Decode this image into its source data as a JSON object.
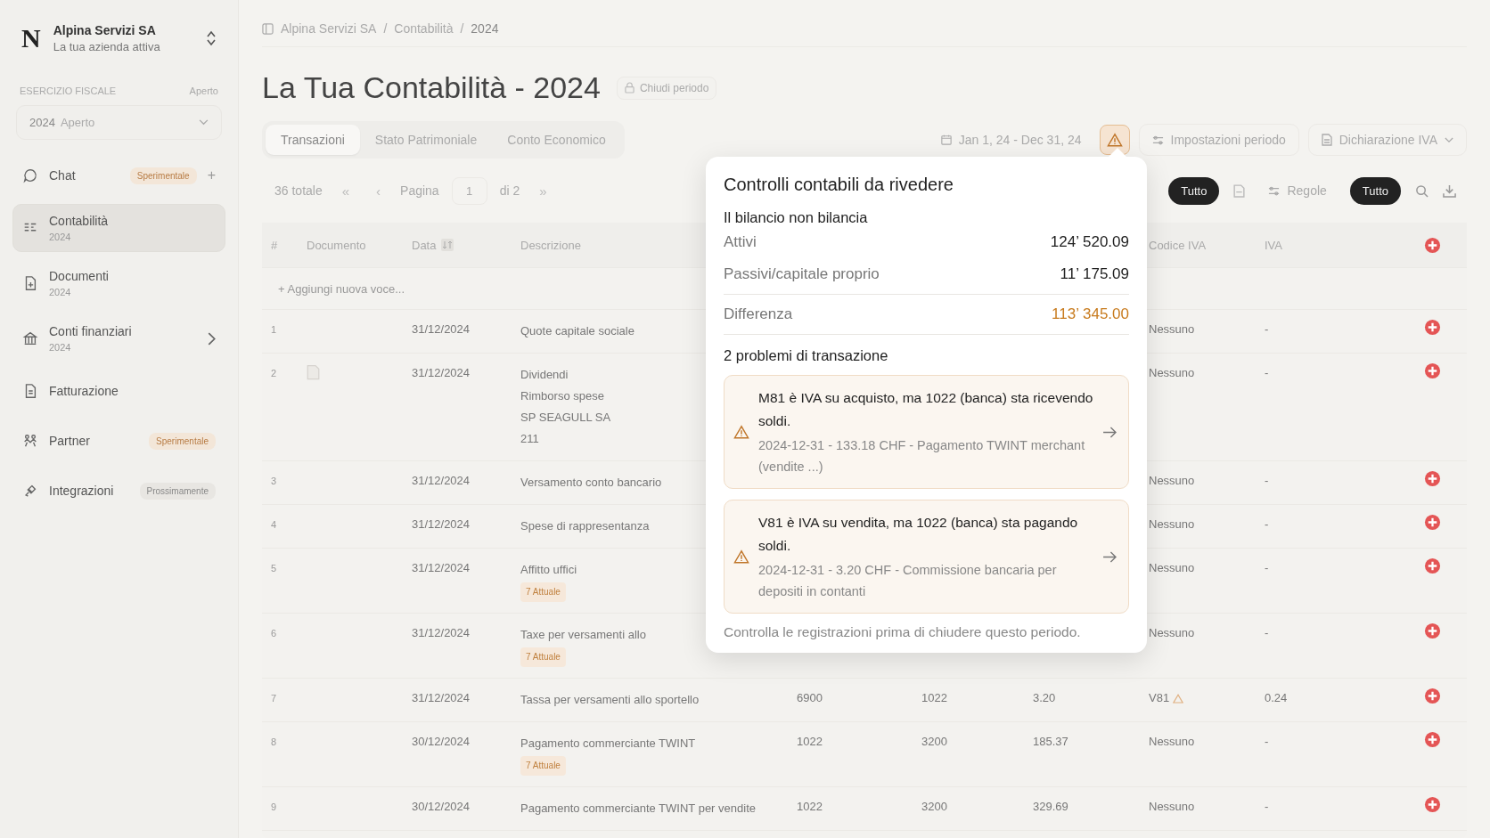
{
  "company": {
    "logo": "N",
    "name": "Alpina Servizi SA",
    "subtitle": "La tua azienda attiva"
  },
  "fiscal_year": {
    "label": "ESERCIZIO FISCALE",
    "status": "Aperto",
    "select_year": "2024",
    "select_status": "Aperto"
  },
  "sidebar": {
    "items": [
      {
        "label": "Chat",
        "kind": "chat",
        "selected": false,
        "badge": {
          "text": "Sperimentale",
          "kind": "experimental"
        },
        "action": "+"
      },
      {
        "label": "Contabilità",
        "sub": "2024",
        "kind": "ledger",
        "selected": true
      },
      {
        "label": "Documenti",
        "sub": "2024",
        "kind": "doc",
        "selected": false
      },
      {
        "label": "Conti finanziari",
        "sub": "2024",
        "kind": "bank",
        "selected": false,
        "chevron": true
      },
      {
        "label": "Fatturazione",
        "kind": "invoice",
        "selected": false
      },
      {
        "label": "Partner",
        "kind": "people",
        "selected": false,
        "badge": {
          "text": "Sperimentale",
          "kind": "experimental"
        }
      },
      {
        "label": "Integrazioni",
        "kind": "plug",
        "selected": false,
        "badge": {
          "text": "Prossimamente",
          "kind": "soon"
        }
      }
    ]
  },
  "breadcrumb": {
    "separator": "/",
    "items": [
      "Alpina Servizi SA",
      "Contabilità",
      "2024"
    ]
  },
  "title": "La Tua Contabilità - 2024",
  "close_period": "Chiudi periodo",
  "tabs": [
    {
      "label": "Transazioni",
      "selected": true
    },
    {
      "label": "Stato Patrimoniale",
      "selected": false
    },
    {
      "label": "Conto Economico",
      "selected": false
    }
  ],
  "date_range": "Jan 1, 24 - Dec 31, 24",
  "period_settings": "Impostazioni periodo",
  "vat_declaration": "Dichiarazione IVA",
  "pager": {
    "total": "36 totale",
    "first": "«",
    "prev": "‹",
    "label": "Pagina",
    "page": "1",
    "of": "di 2",
    "last": "»"
  },
  "filters": {
    "pill_1": "Tutto",
    "rules": "Regole",
    "pill_2": "Tutto"
  },
  "table": {
    "columns": [
      "#",
      "Documento",
      "Data",
      "Descrizione",
      "",
      "",
      "",
      "Codice IVA",
      "IVA"
    ],
    "add_row": "+ Aggiungi nuova voce...",
    "rows": [
      {
        "num": "1",
        "document": false,
        "date": "31/12/2024",
        "description": [
          "Quote capitale sociale"
        ],
        "col_5": "",
        "col_6": "",
        "col_7": "",
        "vat_code": "Nessuno",
        "vat_warning": false,
        "vat": "-"
      },
      {
        "num": "2",
        "document": true,
        "date": "31/12/2024",
        "description": [
          "Dividendi",
          "Rimborso spese",
          "SP SEAGULL SA",
          "211"
        ],
        "col_5": "",
        "col_6": "",
        "col_7": "",
        "vat_code": "Nessuno",
        "vat_warning": false,
        "vat": "-"
      },
      {
        "num": "3",
        "document": false,
        "date": "31/12/2024",
        "description": [
          "Versamento conto bancario"
        ],
        "col_5": "",
        "col_6": "",
        "col_7": "",
        "vat_code": "Nessuno",
        "vat_warning": false,
        "vat": "-"
      },
      {
        "num": "4",
        "document": false,
        "date": "31/12/2024",
        "description": [
          "Spese di rappresentanza"
        ],
        "col_5": "",
        "col_6": "",
        "col_7": "",
        "vat_code": "Nessuno",
        "vat_warning": false,
        "vat": "-"
      },
      {
        "num": "5",
        "document": false,
        "date": "31/12/2024",
        "description": [
          "Affitto uffici"
        ],
        "tag": "7 Attuale",
        "col_5": "",
        "col_6": "",
        "col_7": "",
        "vat_code": "Nessuno",
        "vat_warning": false,
        "vat": "-"
      },
      {
        "num": "6",
        "document": false,
        "date": "31/12/2024",
        "description": [
          "Taxe per versamenti allo"
        ],
        "tag": "7 Attuale",
        "col_5": "",
        "col_6": "",
        "col_7": "",
        "vat_code": "Nessuno",
        "vat_warning": false,
        "vat": "-"
      },
      {
        "num": "7",
        "document": false,
        "date": "31/12/2024",
        "description": [
          "Tassa per versamenti allo sportello"
        ],
        "col_5": "6900",
        "col_6": "1022",
        "col_7": "3.20",
        "vat_code": "V81",
        "vat_warning": true,
        "vat": "0.24"
      },
      {
        "num": "8",
        "document": false,
        "date": "30/12/2024",
        "description": [
          "Pagamento commerciante TWINT"
        ],
        "tag": "7 Attuale",
        "col_5": "1022",
        "col_6": "3200",
        "col_7": "185.37",
        "vat_code": "Nessuno",
        "vat_warning": false,
        "vat": "-"
      },
      {
        "num": "9",
        "document": false,
        "date": "30/12/2024",
        "description": [
          "Pagamento commerciante TWINT per vendite"
        ],
        "col_5": "1022",
        "col_6": "3200",
        "col_7": "329.69",
        "vat_code": "Nessuno",
        "vat_warning": false,
        "vat": "-"
      }
    ]
  },
  "popover": {
    "title": "Controlli contabili da rivedere",
    "balance_heading": "Il bilancio non bilancia",
    "balance": [
      {
        "label": "Attivi",
        "value": "124’ 520.09",
        "kind": "normal"
      },
      {
        "label": "Passivi/capitale proprio",
        "value": "11’ 175.09",
        "kind": "normal"
      },
      {
        "label": "Differenza",
        "value": "113’ 345.00",
        "kind": "difference"
      }
    ],
    "issues_heading": "2 problemi di transazione",
    "issues": [
      {
        "message": "M81 è IVA su acquisto, ma 1022 (banca) sta ricevendo soldi.",
        "detail": "2024-12-31 - 133.18 CHF - Pagamento TWINT merchant (vendite ...)"
      },
      {
        "message": "V81 è IVA su vendita, ma 1022 (banca) sta pagando soldi.",
        "detail": "2024-12-31 - 3.20 CHF - Commissione bancaria per depositi in contanti"
      }
    ],
    "footer": "Controlla le registrazioni prima di chiudere questo periodo."
  }
}
